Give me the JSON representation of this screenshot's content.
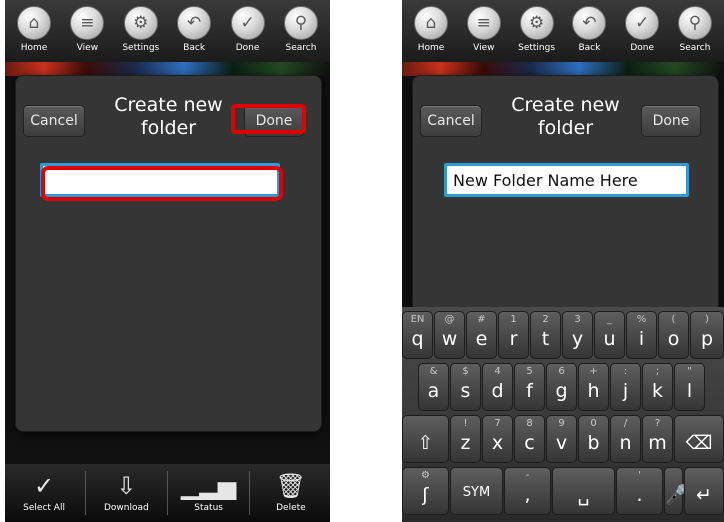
{
  "toolbar": [
    {
      "label": "Home",
      "icon": "home-icon",
      "glyph": "⌂"
    },
    {
      "label": "View",
      "icon": "list-icon",
      "glyph": "≡"
    },
    {
      "label": "Settings",
      "icon": "gear-icon",
      "glyph": "⚙"
    },
    {
      "label": "Back",
      "icon": "back-arrow-icon",
      "glyph": "↶"
    },
    {
      "label": "Done",
      "icon": "checkmark-icon",
      "glyph": "✓"
    },
    {
      "label": "Search",
      "icon": "search-icon",
      "glyph": "⚲"
    }
  ],
  "dialog": {
    "title": "Create new folder",
    "cancel_label": "Cancel",
    "done_label": "Done"
  },
  "left_input_value": "",
  "right_input_value": "New Folder Name Here",
  "bottom_bar": [
    {
      "label": "Select All",
      "icon": "check-circle-icon",
      "glyph": "✓"
    },
    {
      "label": "Download",
      "icon": "download-folder-icon",
      "glyph": "⇩"
    },
    {
      "label": "Status",
      "icon": "bar-chart-icon",
      "glyph": "▁▂▅"
    },
    {
      "label": "Delete",
      "icon": "trash-icon",
      "glyph": "🗑"
    }
  ],
  "keyboard": {
    "row1": [
      {
        "main": "q",
        "sub": "EN"
      },
      {
        "main": "w",
        "sub": "@"
      },
      {
        "main": "e",
        "sub": "#"
      },
      {
        "main": "r",
        "sub": "1"
      },
      {
        "main": "t",
        "sub": "2"
      },
      {
        "main": "y",
        "sub": "3"
      },
      {
        "main": "u",
        "sub": "_"
      },
      {
        "main": "i",
        "sub": "%"
      },
      {
        "main": "o",
        "sub": "("
      },
      {
        "main": "p",
        "sub": ")"
      }
    ],
    "row2": [
      {
        "main": "a",
        "sub": "&"
      },
      {
        "main": "s",
        "sub": "$"
      },
      {
        "main": "d",
        "sub": "4"
      },
      {
        "main": "f",
        "sub": "5"
      },
      {
        "main": "g",
        "sub": "6"
      },
      {
        "main": "h",
        "sub": "+"
      },
      {
        "main": "j",
        "sub": ":"
      },
      {
        "main": "k",
        "sub": ";"
      },
      {
        "main": "l",
        "sub": "\""
      }
    ],
    "row3": [
      {
        "main": "⇧",
        "sub": ""
      },
      {
        "main": "z",
        "sub": "!"
      },
      {
        "main": "x",
        "sub": "7"
      },
      {
        "main": "c",
        "sub": "8"
      },
      {
        "main": "v",
        "sub": "9"
      },
      {
        "main": "b",
        "sub": "0"
      },
      {
        "main": "n",
        "sub": "/"
      },
      {
        "main": "m",
        "sub": "?"
      },
      {
        "main": "⌫",
        "sub": ""
      }
    ],
    "row4": [
      {
        "main": "ʃ",
        "sub": "⚙"
      },
      {
        "main": "SYM",
        "sub": ""
      },
      {
        "main": ",",
        "sub": "-"
      },
      {
        "main": "␣",
        "sub": ""
      },
      {
        "main": ".",
        "sub": "'"
      },
      {
        "main": "🎤",
        "sub": ""
      },
      {
        "main": "↵",
        "sub": ""
      }
    ]
  },
  "colors": {
    "highlight": "#e10000",
    "input_focus": "#2c9bd6"
  }
}
